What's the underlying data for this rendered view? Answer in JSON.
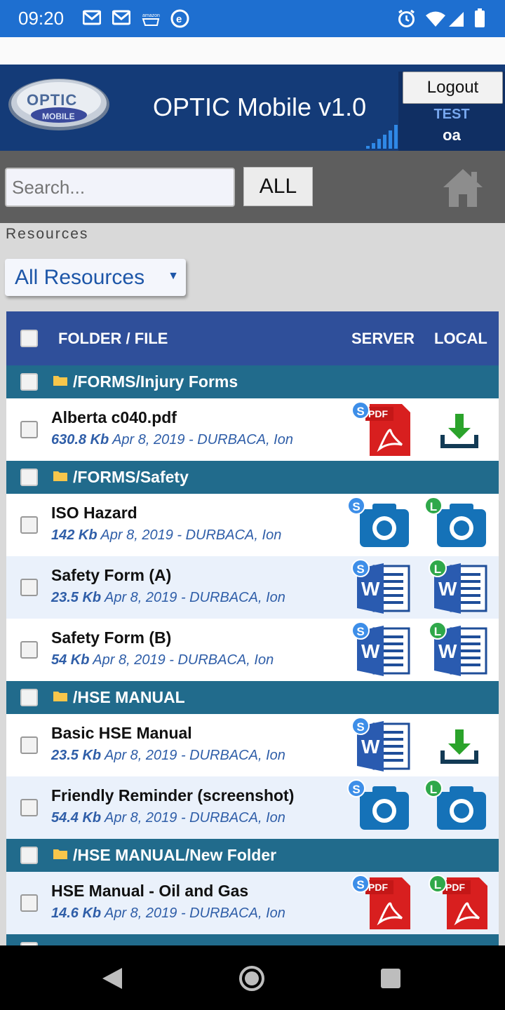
{
  "status_bar": {
    "time": "09:20",
    "icons": [
      "gmail-icon",
      "gmail-icon",
      "amazon-icon",
      "e-icon",
      "alarm-icon",
      "wifi-icon",
      "signal-icon",
      "battery-icon"
    ]
  },
  "header": {
    "logo_text": "OPTIC",
    "logo_sub": "MOBILE",
    "title": "OPTIC Mobile v1.0",
    "logout_label": "Logout",
    "user_env": "TEST",
    "user_name": "oa"
  },
  "toolbar": {
    "search_placeholder": "Search...",
    "all_label": "ALL"
  },
  "resources": {
    "label": "Resources",
    "selected": "All Resources"
  },
  "table": {
    "headers": {
      "folder_file": "FOLDER / FILE",
      "server": "SERVER",
      "local": "LOCAL"
    },
    "folders": [
      {
        "name": "/FORMS/Injury Forms"
      },
      {
        "name": "/FORMS/Safety"
      },
      {
        "name": "/HSE MANUAL"
      },
      {
        "name": "/HSE MANUAL/New Folder"
      }
    ],
    "files": [
      {
        "name": "Alberta c040.pdf",
        "size": "630.8 Kb",
        "info": "Apr 8, 2019 - DURBACA, Ion",
        "server_icon": "pdf-icon",
        "local_icon": "download-icon"
      },
      {
        "name": "ISO Hazard",
        "size": "142 Kb",
        "info": "Apr 8, 2019 - DURBACA, Ion",
        "server_icon": "camera-icon",
        "local_icon": "camera-icon"
      },
      {
        "name": "Safety Form (A)",
        "size": "23.5 Kb",
        "info": "Apr 8, 2019 - DURBACA, Ion",
        "server_icon": "word-icon",
        "local_icon": "word-icon"
      },
      {
        "name": "Safety Form (B)",
        "size": "54 Kb",
        "info": "Apr 8, 2019 - DURBACA, Ion",
        "server_icon": "word-icon",
        "local_icon": "word-icon"
      },
      {
        "name": "Basic HSE Manual",
        "size": "23.5 Kb",
        "info": "Apr 8, 2019 - DURBACA, Ion",
        "server_icon": "word-icon",
        "local_icon": "download-icon"
      },
      {
        "name": "Friendly Reminder (screenshot)",
        "size": "54.4 Kb",
        "info": "Apr 8, 2019 - DURBACA, Ion",
        "server_icon": "camera-icon",
        "local_icon": "camera-icon"
      },
      {
        "name": "HSE Manual - Oil and Gas",
        "size": "14.6 Kb",
        "info": "Apr 8, 2019 - DURBACA, Ion",
        "server_icon": "pdf-icon",
        "local_icon": "pdf-icon"
      }
    ],
    "badges": {
      "server": "S",
      "local": "L"
    }
  },
  "colors": {
    "status_bar": "#1e6fd0",
    "header": "#143b78",
    "table_header": "#2f4f9a",
    "folder_row": "#216b8c",
    "meta_text": "#2f5ea8"
  }
}
